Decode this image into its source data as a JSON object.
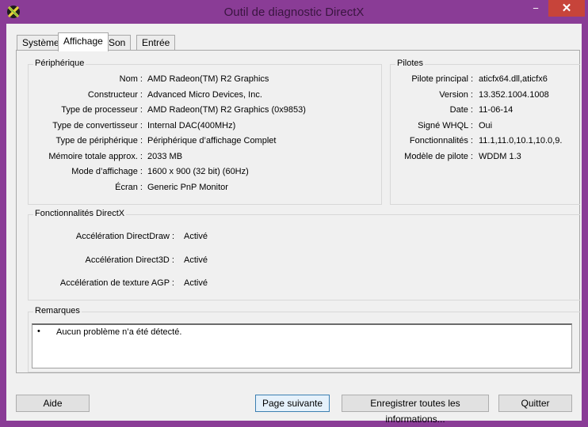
{
  "window": {
    "title": "Outil de diagnostic DirectX",
    "min": "−",
    "max": "☐",
    "close": "✕"
  },
  "tabs": [
    "Système",
    "Affichage",
    "Son",
    "Entrée"
  ],
  "device": {
    "title": "Périphérique",
    "rows": [
      {
        "label": "Nom :",
        "value": "AMD Radeon(TM) R2 Graphics"
      },
      {
        "label": "Constructeur :",
        "value": "Advanced Micro Devices, Inc."
      },
      {
        "label": "Type de processeur :",
        "value": "AMD Radeon(TM) R2 Graphics (0x9853)"
      },
      {
        "label": "Type de convertisseur :",
        "value": "Internal DAC(400MHz)"
      },
      {
        "label": "Type de périphérique :",
        "value": "Périphérique d’affichage Complet"
      },
      {
        "label": "Mémoire totale approx. :",
        "value": "2033 MB"
      },
      {
        "label": "Mode d’affichage :",
        "value": "1600 x 900 (32 bit) (60Hz)"
      },
      {
        "label": "Écran :",
        "value": "Generic PnP Monitor"
      }
    ]
  },
  "drivers": {
    "title": "Pilotes",
    "rows": [
      {
        "label": "Pilote principal :",
        "value": "aticfx64.dll,aticfx6"
      },
      {
        "label": "Version :",
        "value": "13.352.1004.1008"
      },
      {
        "label": "Date :",
        "value": "11-06-14"
      },
      {
        "label": "Signé WHQL :",
        "value": "Oui"
      },
      {
        "label": "Fonctionnalités :",
        "value": "11.1,11.0,10.1,10.0,9."
      },
      {
        "label": "Modèle de pilote :",
        "value": "WDDM 1.3"
      }
    ]
  },
  "features": {
    "title": "Fonctionnalités DirectX",
    "rows": [
      {
        "label": "Accélération DirectDraw :",
        "value": "Activé"
      },
      {
        "label": "Accélération Direct3D :",
        "value": "Activé"
      },
      {
        "label": "Accélération de texture AGP :",
        "value": "Activé"
      }
    ]
  },
  "notes": {
    "title": "Remarques",
    "items": [
      "Aucun problème n’a été détecté."
    ]
  },
  "buttons": {
    "help": "Aide",
    "next": "Page suivante",
    "save": "Enregistrer toutes les informations...",
    "quit": "Quitter"
  }
}
